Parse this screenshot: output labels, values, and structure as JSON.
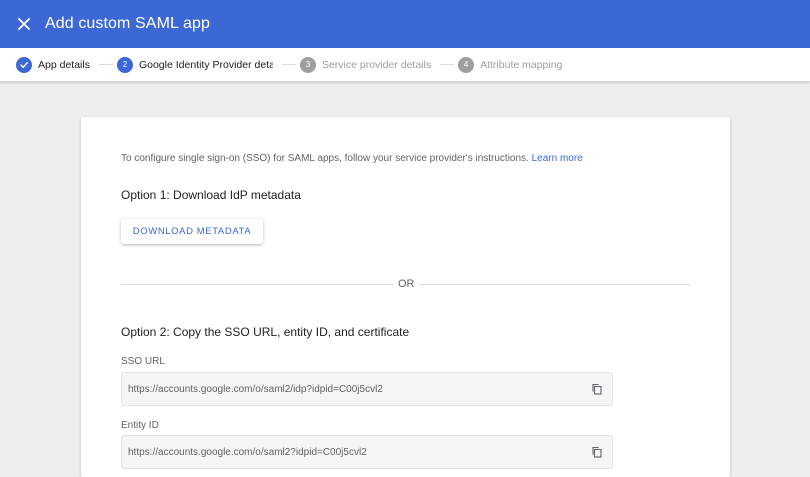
{
  "header": {
    "title": "Add custom SAML app",
    "close_icon": "close-icon"
  },
  "stepper": {
    "steps": [
      {
        "number": "",
        "label": "App details",
        "state": "done"
      },
      {
        "number": "2",
        "label": "Google Identity Provider details",
        "state": "active"
      },
      {
        "number": "3",
        "label": "Service provider details",
        "state": "pending"
      },
      {
        "number": "4",
        "label": "Attribute mapping",
        "state": "pending"
      }
    ]
  },
  "main": {
    "intro_text": "To configure single sign-on (SSO) for SAML apps, follow your service provider's instructions.",
    "learn_more": "Learn more",
    "option1_title": "Option 1: Download IdP metadata",
    "download_button": "DOWNLOAD METADATA",
    "or_text": "OR",
    "option2_title": "Option 2: Copy the SSO URL, entity ID, and certificate",
    "sso_url_label": "SSO URL",
    "sso_url_value": "https://accounts.google.com/o/saml2/idp?idpid=C00j5cvl2",
    "entity_id_label": "Entity ID",
    "entity_id_value": "https://accounts.google.com/o/saml2?idpid=C00j5cvl2"
  },
  "colors": {
    "brand": "#3b68d4",
    "pending": "#9e9e9e",
    "background": "#eeeeee"
  }
}
